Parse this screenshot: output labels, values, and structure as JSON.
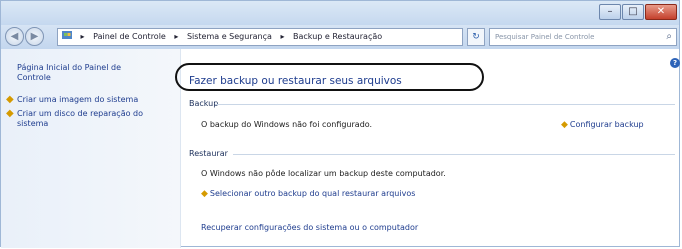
{
  "window": {
    "min_glyph": "–",
    "max_glyph": "□",
    "close_glyph": "✕"
  },
  "nav": {
    "back_glyph": "◀",
    "forward_glyph": "▶",
    "breadcrumb": [
      "Painel de Controle",
      "Sistema e Segurança",
      "Backup e Restauração"
    ],
    "separator": "▸",
    "refresh_glyph": "↻",
    "search_placeholder": "Pesquisar Painel de Controle",
    "search_icon": "magnifier-icon"
  },
  "sidebar": {
    "home_link": "Página Inicial do Painel de Controle",
    "links": [
      {
        "icon": "shield-icon",
        "label": "Criar uma imagem do sistema"
      },
      {
        "icon": "shield-icon",
        "label": "Criar um disco de reparação do sistema"
      }
    ]
  },
  "main": {
    "title": "Fazer backup ou restaurar seus arquivos",
    "help_glyph": "?",
    "backup_section": "Backup",
    "backup_status": "O backup do Windows não foi configurado.",
    "configure_backup": "Configurar backup",
    "restore_section": "Restaurar",
    "restore_status": "O Windows não pôde localizar um backup deste computador.",
    "restore_link": "Selecionar outro backup do qual restaurar arquivos",
    "recover_link": "Recuperar configurações do sistema ou o computador"
  },
  "colors": {
    "link": "#1e3c8e",
    "shield": "#d59a00",
    "close": "#c4402c",
    "highlight_oval": "#111111"
  }
}
